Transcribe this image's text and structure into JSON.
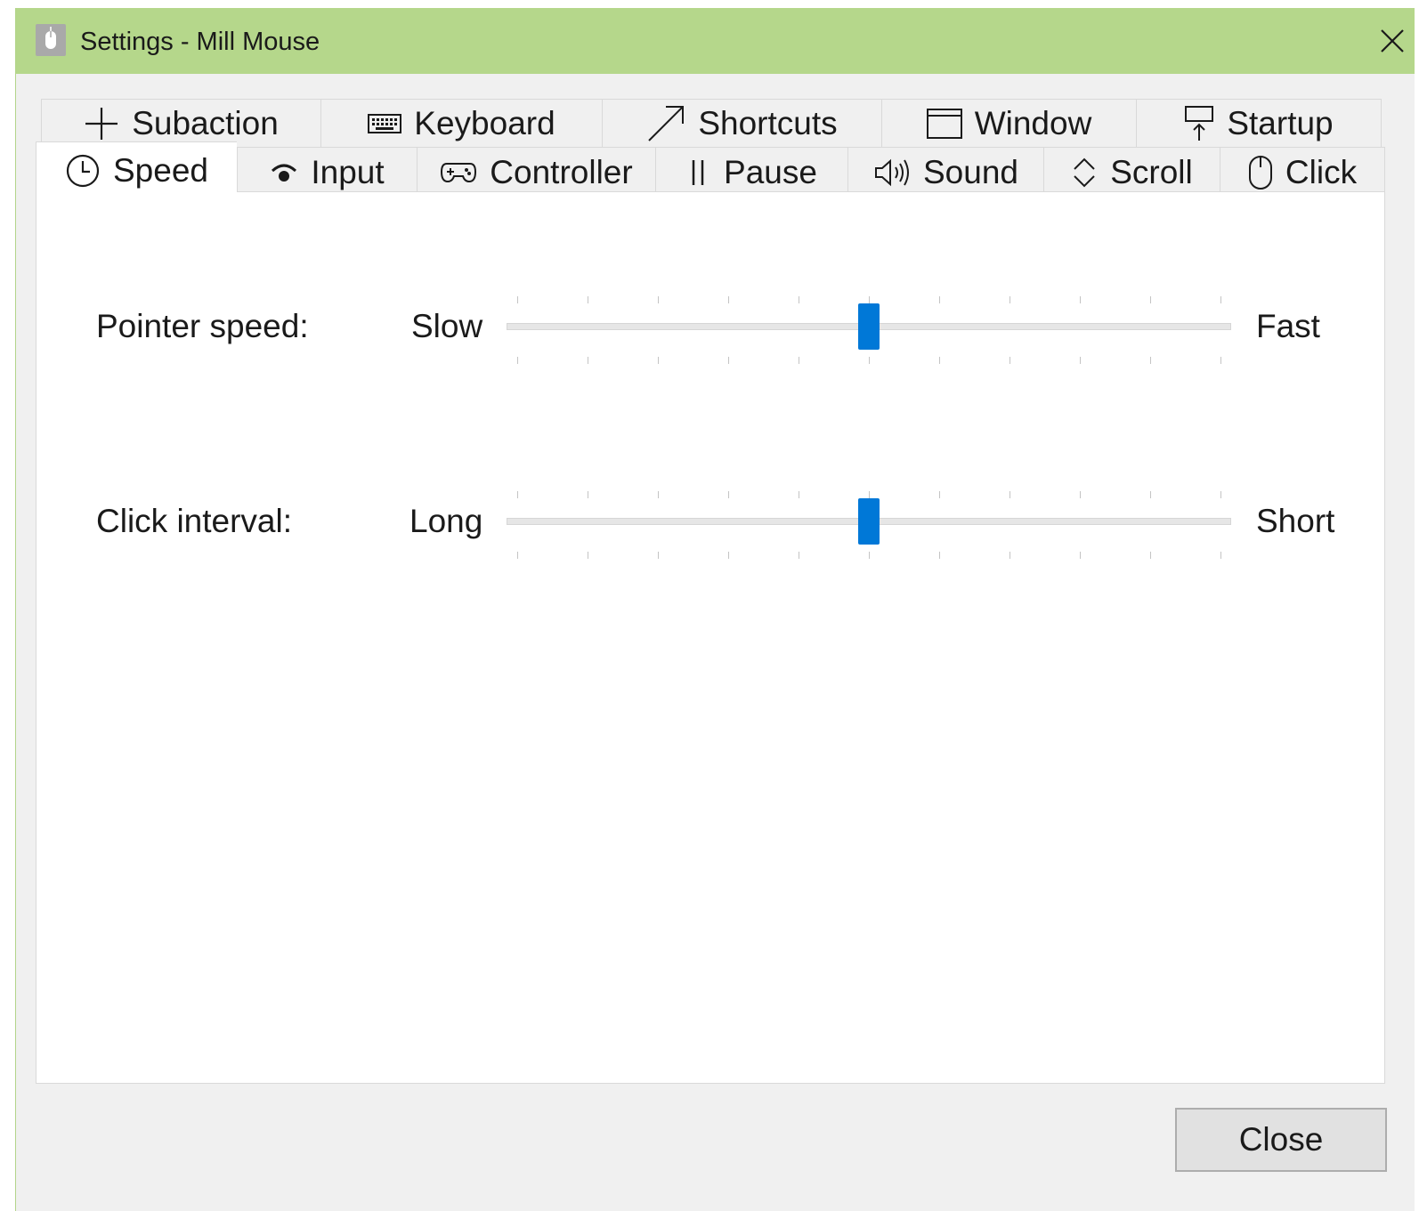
{
  "window": {
    "title": "Settings - Mill Mouse",
    "titlebar_color": "#b5d78b",
    "accent_color": "#0078d7"
  },
  "tabs": {
    "back_row": [
      {
        "label": "Subaction",
        "icon": "plus-icon"
      },
      {
        "label": "Keyboard",
        "icon": "keyboard-icon"
      },
      {
        "label": "Shortcuts",
        "icon": "arrow-up-right-icon"
      },
      {
        "label": "Window",
        "icon": "window-icon"
      },
      {
        "label": "Startup",
        "icon": "startup-icon"
      }
    ],
    "front_row": [
      {
        "label": "Speed",
        "icon": "clock-icon",
        "selected": true
      },
      {
        "label": "Input",
        "icon": "input-icon"
      },
      {
        "label": "Controller",
        "icon": "gamepad-icon"
      },
      {
        "label": "Pause",
        "icon": "pause-icon"
      },
      {
        "label": "Sound",
        "icon": "speaker-icon"
      },
      {
        "label": "Scroll",
        "icon": "scroll-icon"
      },
      {
        "label": "Click",
        "icon": "mouse-icon"
      }
    ]
  },
  "speed_panel": {
    "pointer_speed": {
      "label": "Pointer speed:",
      "min_label": "Slow",
      "max_label": "Fast",
      "value_fraction": 0.5,
      "tick_count": 11
    },
    "click_interval": {
      "label": "Click interval:",
      "min_label": "Long",
      "max_label": "Short",
      "value_fraction": 0.5,
      "tick_count": 11
    }
  },
  "footer": {
    "close_label": "Close"
  }
}
